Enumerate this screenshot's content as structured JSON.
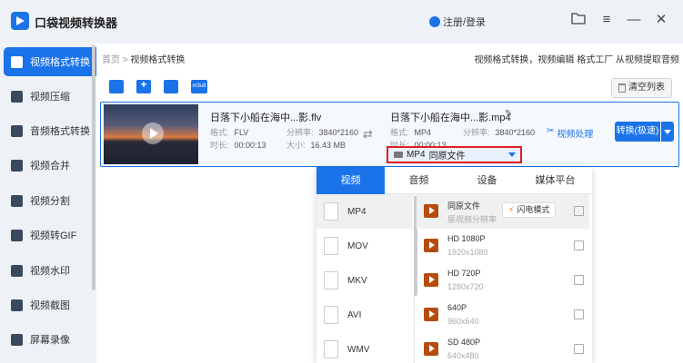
{
  "app": {
    "title": "口袋视频转换器",
    "login": "注册/登录"
  },
  "window": {
    "icons": [
      "folder-icon",
      "menu-icon",
      "minimize-icon",
      "close-icon"
    ]
  },
  "sidebar": {
    "items": [
      {
        "label": "视频格式转换",
        "active": true
      },
      {
        "label": "视频压缩"
      },
      {
        "label": "音频格式转换"
      },
      {
        "label": "视频合并"
      },
      {
        "label": "视频分割"
      },
      {
        "label": "视频转GIF"
      },
      {
        "label": "视频水印"
      },
      {
        "label": "视频截图"
      },
      {
        "label": "屏幕录像"
      }
    ]
  },
  "breadcrumb": {
    "home": "首页",
    "sep": ">",
    "current": "视频格式转换"
  },
  "features_line": "视频格式转换，视频编辑 格式工厂 从视频提取音频",
  "toolbar": {
    "m3u8": "m3u8",
    "clear": "清空列表"
  },
  "file": {
    "source": {
      "name": "日落下小船在海中...影.flv",
      "format_label": "格式:",
      "format": "FLV",
      "res_label": "分辨率:",
      "res": "3840*2160",
      "dur_label": "时长:",
      "duration": "00:00:13",
      "size_label": "大小:",
      "size": "16.43 MB"
    },
    "target": {
      "name": "日落下小船在海中...影.mp4",
      "format_label": "格式:",
      "format": "MP4",
      "res_label": "分辨率:",
      "res": "3840*2160",
      "dur_label": "时长:",
      "duration": "00:00:13"
    },
    "video_process": "视频处理",
    "convert": "转换(极速)",
    "select": {
      "format": "MP4",
      "preset": "同原文件"
    }
  },
  "panel": {
    "tabs": [
      {
        "label": "视频",
        "active": true
      },
      {
        "label": "音频"
      },
      {
        "label": "设备"
      },
      {
        "label": "媒体平台"
      }
    ],
    "formats": [
      {
        "label": "MP4",
        "color": "#d84315",
        "active": true
      },
      {
        "label": "MOV",
        "color": "#1565c0"
      },
      {
        "label": "MKV",
        "color": "#2e7d32"
      },
      {
        "label": "AVI",
        "color": "#ef8a00"
      },
      {
        "label": "WMV",
        "color": "#2aa876"
      }
    ],
    "presets": [
      {
        "name": "同原文件",
        "sub": "原视频分辨率",
        "badge": "闪电模式",
        "active": true
      },
      {
        "name": "HD 1080P",
        "sub": "1920x1080"
      },
      {
        "name": "HD 720P",
        "sub": "1280x720"
      },
      {
        "name": "640P",
        "sub": "960x640"
      },
      {
        "name": "SD 480P",
        "sub": "640x480"
      }
    ]
  },
  "colors": {
    "accent": "#1a73e8",
    "highlight_border": "#e02020"
  }
}
